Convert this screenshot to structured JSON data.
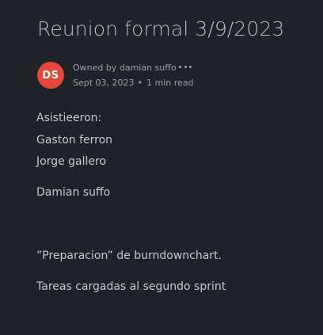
{
  "page": {
    "title": "Reunion formal 3/9/2023"
  },
  "author": {
    "initials": "DS",
    "owned_by": "Owned by damian suffo",
    "date": "Sept 03, 2023",
    "separator": "•",
    "read_time": "1 min read",
    "avatar_color": "#e5483a"
  },
  "body": {
    "lines": [
      "Asistieeron:",
      "Gaston ferron",
      "Jorge gallero",
      "Damian suffo",
      "”Preparacion” de burndownchart.",
      "Tareas cargadas al segundo sprint"
    ]
  }
}
